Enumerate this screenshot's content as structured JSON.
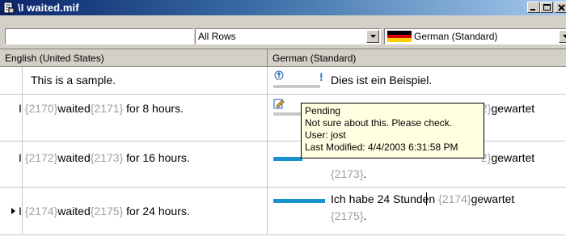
{
  "window": {
    "title": "\\I waited.mif",
    "icons": {
      "app": "document-icon",
      "minimize": "minimize-icon",
      "maximize": "maximize-icon",
      "close": "close-icon"
    }
  },
  "toolbar": {
    "search": {
      "value": "",
      "placeholder": ""
    },
    "row_filter": {
      "selected": "All Rows"
    },
    "language": {
      "selected": "German (Standard)",
      "flag_colors": [
        "#000000",
        "#dd0000",
        "#ffce00"
      ]
    }
  },
  "grid": {
    "columns": [
      "English (United States)",
      "German (Standard)"
    ],
    "rows": [
      {
        "source": {
          "text": "This is a sample."
        },
        "target": {
          "text": "Dies ist ein Beispiel.",
          "status_icon": "comment-icon",
          "has_note_marker": true
        }
      },
      {
        "source": {
          "pre": "I ",
          "tag1": "{2170}",
          "mid": "waited",
          "tag2": "{2171}",
          "post": " for 8 hours."
        },
        "target": {
          "status_icon": "edit-icon",
          "visible_tail_tag": "2}",
          "visible_tail": "gewartet"
        }
      },
      {
        "source": {
          "pre": "I ",
          "tag1": "{2172}",
          "mid": "waited",
          "tag2": "{2173}",
          "post": " for 16 hours."
        },
        "target": {
          "visible_tail_tag": "2}",
          "visible_tail": "gewartet",
          "line2_tag": "{2173}",
          "line2_post": "."
        }
      },
      {
        "current": true,
        "source": {
          "pre": "I ",
          "tag1": "{2174}",
          "mid": "waited",
          "tag2": "{2175}",
          "post": " for 24 hours."
        },
        "target": {
          "line1_pre": "Ich habe 24 Stunden ",
          "line1_tag": "{2174}",
          "line1_post": "gewartet",
          "line2_tag": "{2175}",
          "line2_post": "."
        }
      }
    ]
  },
  "tooltip": {
    "lines": [
      "Pending",
      "Not sure about this. Please check.",
      "User: jost",
      "Last Modified: 4/4/2003 6:31:58 PM"
    ]
  },
  "colors": {
    "title_start": "#0a246a",
    "title_end": "#a6caf0",
    "status_bar": "#1b92d0",
    "tag": "#a0a0a0",
    "tooltip_bg": "#ffffe1"
  }
}
